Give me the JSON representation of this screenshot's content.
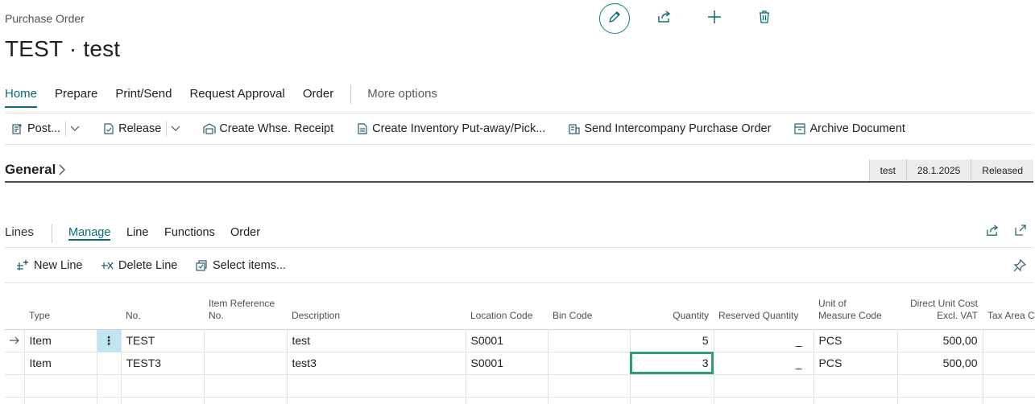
{
  "page": {
    "caption": "Purchase Order",
    "title": "TEST · test",
    "title_actions": [
      {
        "name": "edit-icon"
      },
      {
        "name": "share-icon"
      },
      {
        "name": "plus-icon"
      },
      {
        "name": "delete-icon"
      }
    ]
  },
  "tabs": {
    "home": "Home",
    "prepare": "Prepare",
    "print_send": "Print/Send",
    "request_approval": "Request Approval",
    "order": "Order",
    "more_options": "More options",
    "active": "Home"
  },
  "actions": {
    "post": "Post...",
    "release": "Release",
    "create_whse_receipt": "Create Whse. Receipt",
    "create_inventory_putaway": "Create Inventory Put-away/Pick...",
    "send_intercompany": "Send Intercompany Purchase Order",
    "archive_document": "Archive Document"
  },
  "general": {
    "header": "General",
    "pills": [
      "test",
      "28.1.2025",
      "Released"
    ]
  },
  "lines": {
    "label": "Lines",
    "tabs": {
      "manage": "Manage",
      "line": "Line",
      "functions": "Functions",
      "order": "Order"
    },
    "actions": {
      "new_line": "New Line",
      "delete_line": "Delete Line",
      "select_items": "Select items..."
    },
    "columns": {
      "type": "Type",
      "no": "No.",
      "item_ref_1": "Item Reference",
      "item_ref_2": "No.",
      "description": "Description",
      "location_code": "Location Code",
      "bin_code": "Bin Code",
      "quantity": "Quantity",
      "reserved_quantity": "Reserved Quantity",
      "uom_1": "Unit of",
      "uom_2": "Measure Code",
      "direct_cost_1": "Direct Unit Cost",
      "direct_cost_2": "Excl. VAT",
      "tax_area": "Tax Area Co"
    },
    "rows": [
      {
        "type": "Item",
        "no": "TEST",
        "item_ref": "",
        "description": "test",
        "location_code": "S0001",
        "bin_code": "",
        "quantity": "5",
        "reserved": "_",
        "uom": "PCS",
        "direct_cost": "500,00",
        "tax_area": ""
      },
      {
        "type": "Item",
        "no": "TEST3",
        "item_ref": "",
        "description": "test3",
        "location_code": "S0001",
        "bin_code": "",
        "quantity": "3",
        "reserved": "_",
        "uom": "PCS",
        "direct_cost": "500,00",
        "tax_area": ""
      }
    ]
  },
  "colors": {
    "accent": "#0b6a78",
    "focus": "#2e9c7f",
    "selected": "#bfe6ec"
  }
}
